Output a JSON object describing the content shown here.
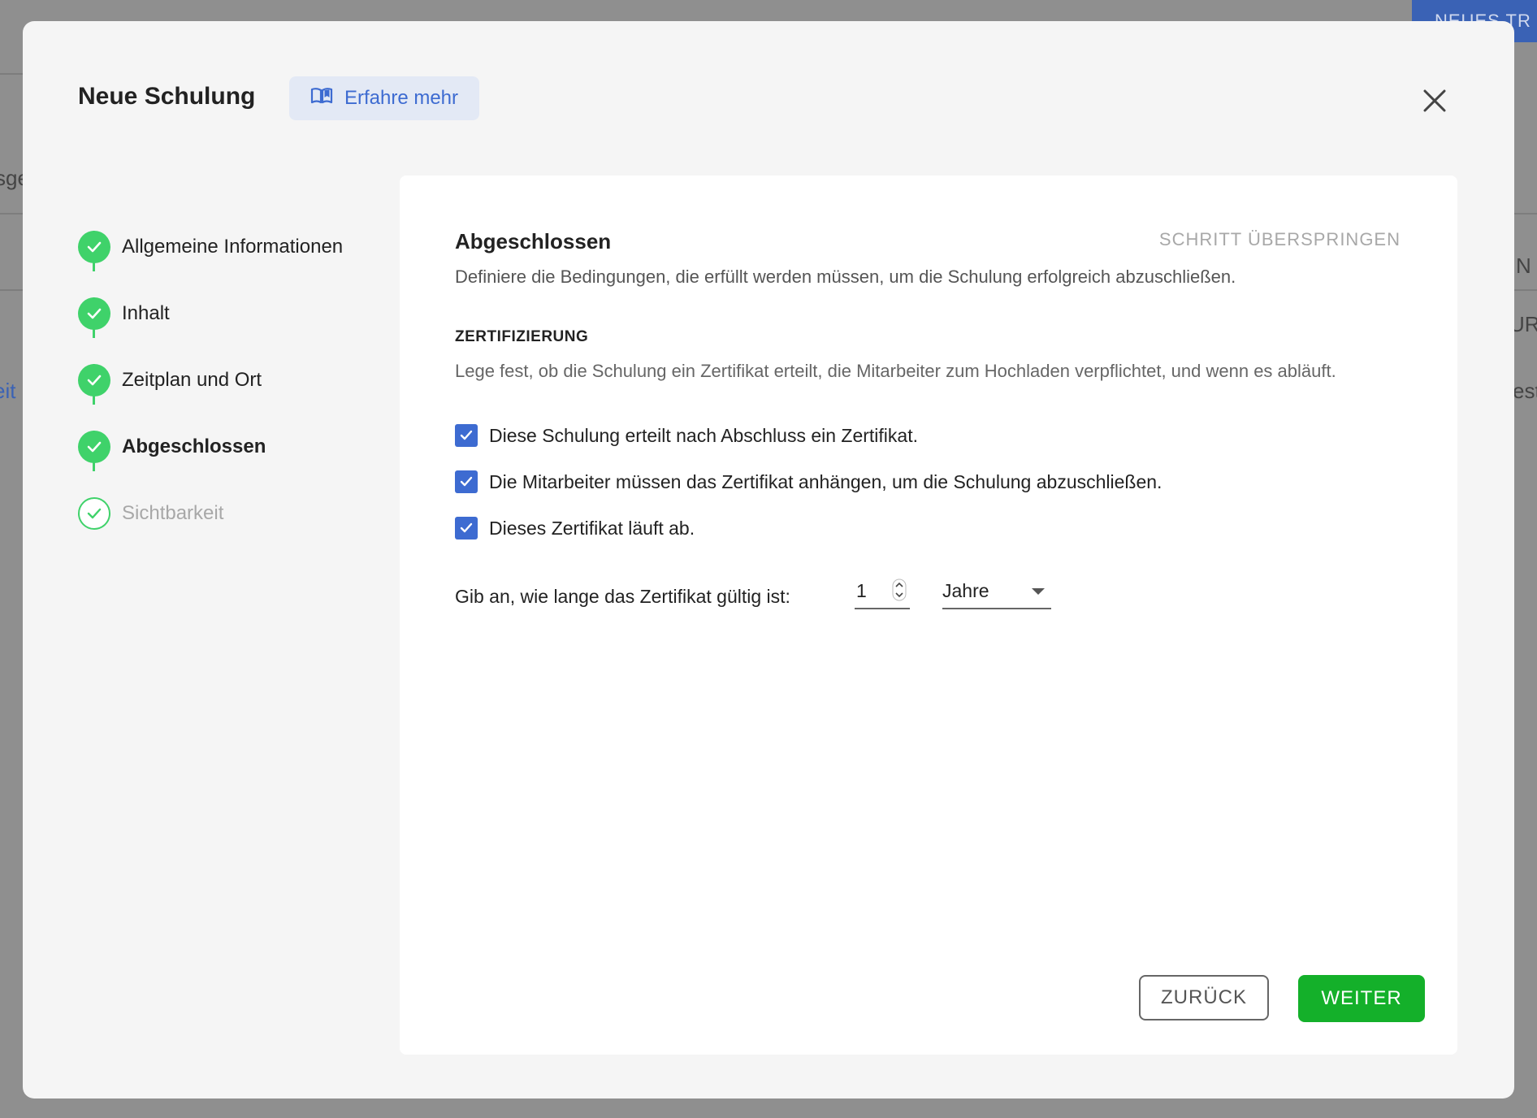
{
  "background": {
    "new_button_fragment": "NEUES TR",
    "fragments": [
      "sge",
      "eit",
      "N",
      "UR",
      "est"
    ]
  },
  "modal": {
    "title": "Neue Schulung",
    "learn_more": "Erfahre mehr",
    "learn_more_icon": "open-book-icon",
    "close_icon": "close-icon"
  },
  "stepper": {
    "steps": [
      {
        "label": "Allgemeine Informationen",
        "state": "done"
      },
      {
        "label": "Inhalt",
        "state": "done"
      },
      {
        "label": "Zeitplan und Ort",
        "state": "done"
      },
      {
        "label": "Abgeschlossen",
        "state": "current"
      },
      {
        "label": "Sichtbarkeit",
        "state": "upcoming"
      }
    ]
  },
  "content": {
    "title": "Abgeschlossen",
    "skip": "SCHRITT ÜBERSPRINGEN",
    "description": "Definiere die Bedingungen, die erfüllt werden müssen, um die Schulung erfolgreich abzuschließen.",
    "section_title": "ZERTIFIZIERUNG",
    "section_description": "Lege fest, ob die Schulung ein Zertifikat erteilt, die Mitarbeiter zum Hochladen verpflichtet, und wenn es abläuft.",
    "checkboxes": [
      {
        "label": "Diese Schulung erteilt nach Abschluss ein Zertifikat.",
        "checked": true
      },
      {
        "label": "Die Mitarbeiter müssen das Zertifikat anhängen, um die Schulung abzuschließen.",
        "checked": true
      },
      {
        "label": "Dieses Zertifikat läuft ab.",
        "checked": true
      }
    ],
    "validity_label": "Gib an, wie lange das Zertifikat gültig ist:",
    "validity_value": "1",
    "validity_unit": "Jahre",
    "back_button": "ZURÜCK",
    "next_button": "WEITER"
  },
  "colors": {
    "accent_blue": "#3d6bd1",
    "step_green": "#3fd26a",
    "next_green": "#14b02a"
  }
}
